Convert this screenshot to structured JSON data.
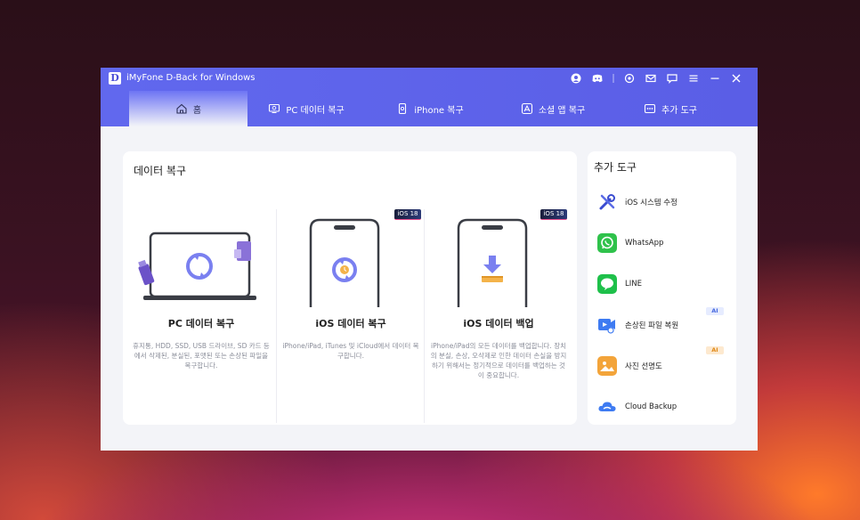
{
  "app": {
    "logo_letter": "D",
    "title": "iMyFone D-Back for Windows"
  },
  "window_controls": [
    {
      "name": "account-icon"
    },
    {
      "name": "discord-icon"
    },
    {
      "name": "settings-icon"
    },
    {
      "name": "mail-icon"
    },
    {
      "name": "feedback-icon"
    },
    {
      "name": "menu-icon"
    },
    {
      "name": "minimize-icon"
    },
    {
      "name": "close-icon"
    }
  ],
  "tabs": [
    {
      "label": "홈",
      "icon": "home-icon",
      "active": true
    },
    {
      "label": "PC 데이터 복구",
      "icon": "pc-icon"
    },
    {
      "label": "iPhone 복구",
      "icon": "iphone-icon"
    },
    {
      "label": "소셜 앱 복구",
      "icon": "social-app-icon"
    },
    {
      "label": "추가 도구",
      "icon": "more-icon"
    }
  ],
  "main": {
    "title": "데이터 복구",
    "cards": [
      {
        "title": "PC 데이터 복구",
        "desc": "휴지통, HDD, SSD, USB 드라이브, SD 카드 등에서 삭제된, 분실된, 포맷된 또는 손상된 파일을 복구합니다."
      },
      {
        "title": "iOS 데이터 복구",
        "badge": "iOS 18",
        "desc": "iPhone/iPad, iTunes 및 iCloud에서 데이터 복구합니다."
      },
      {
        "title": "iOS 데이터 백업",
        "badge": "iOS 18",
        "desc": "iPhone/iPad의 모든 데이터를 백업합니다. 장치의 분실, 손상, 오삭제로 인한 데이터 손실을 방지하기 위해서는 정기적으로 데이터를 백업하는 것이 중요합니다."
      }
    ]
  },
  "side": {
    "title": "추가 도구",
    "items": [
      {
        "label": "iOS 시스템 수정",
        "icon": "tools-icon"
      },
      {
        "label": "WhatsApp",
        "icon": "whatsapp-icon"
      },
      {
        "label": "LINE",
        "icon": "line-icon"
      },
      {
        "label": "손상된 파일 복원",
        "icon": "video-repair-icon",
        "badge": "AI"
      },
      {
        "label": "사진 선명도",
        "icon": "photo-enhance-icon",
        "badge": "AI"
      },
      {
        "label": "Cloud Backup",
        "icon": "cloud-icon"
      }
    ]
  },
  "colors": {
    "accent": "#5a5ee6",
    "whatsapp": "#2fc24b",
    "line": "#1ec04a",
    "ai_badge": "#f3a43a"
  }
}
